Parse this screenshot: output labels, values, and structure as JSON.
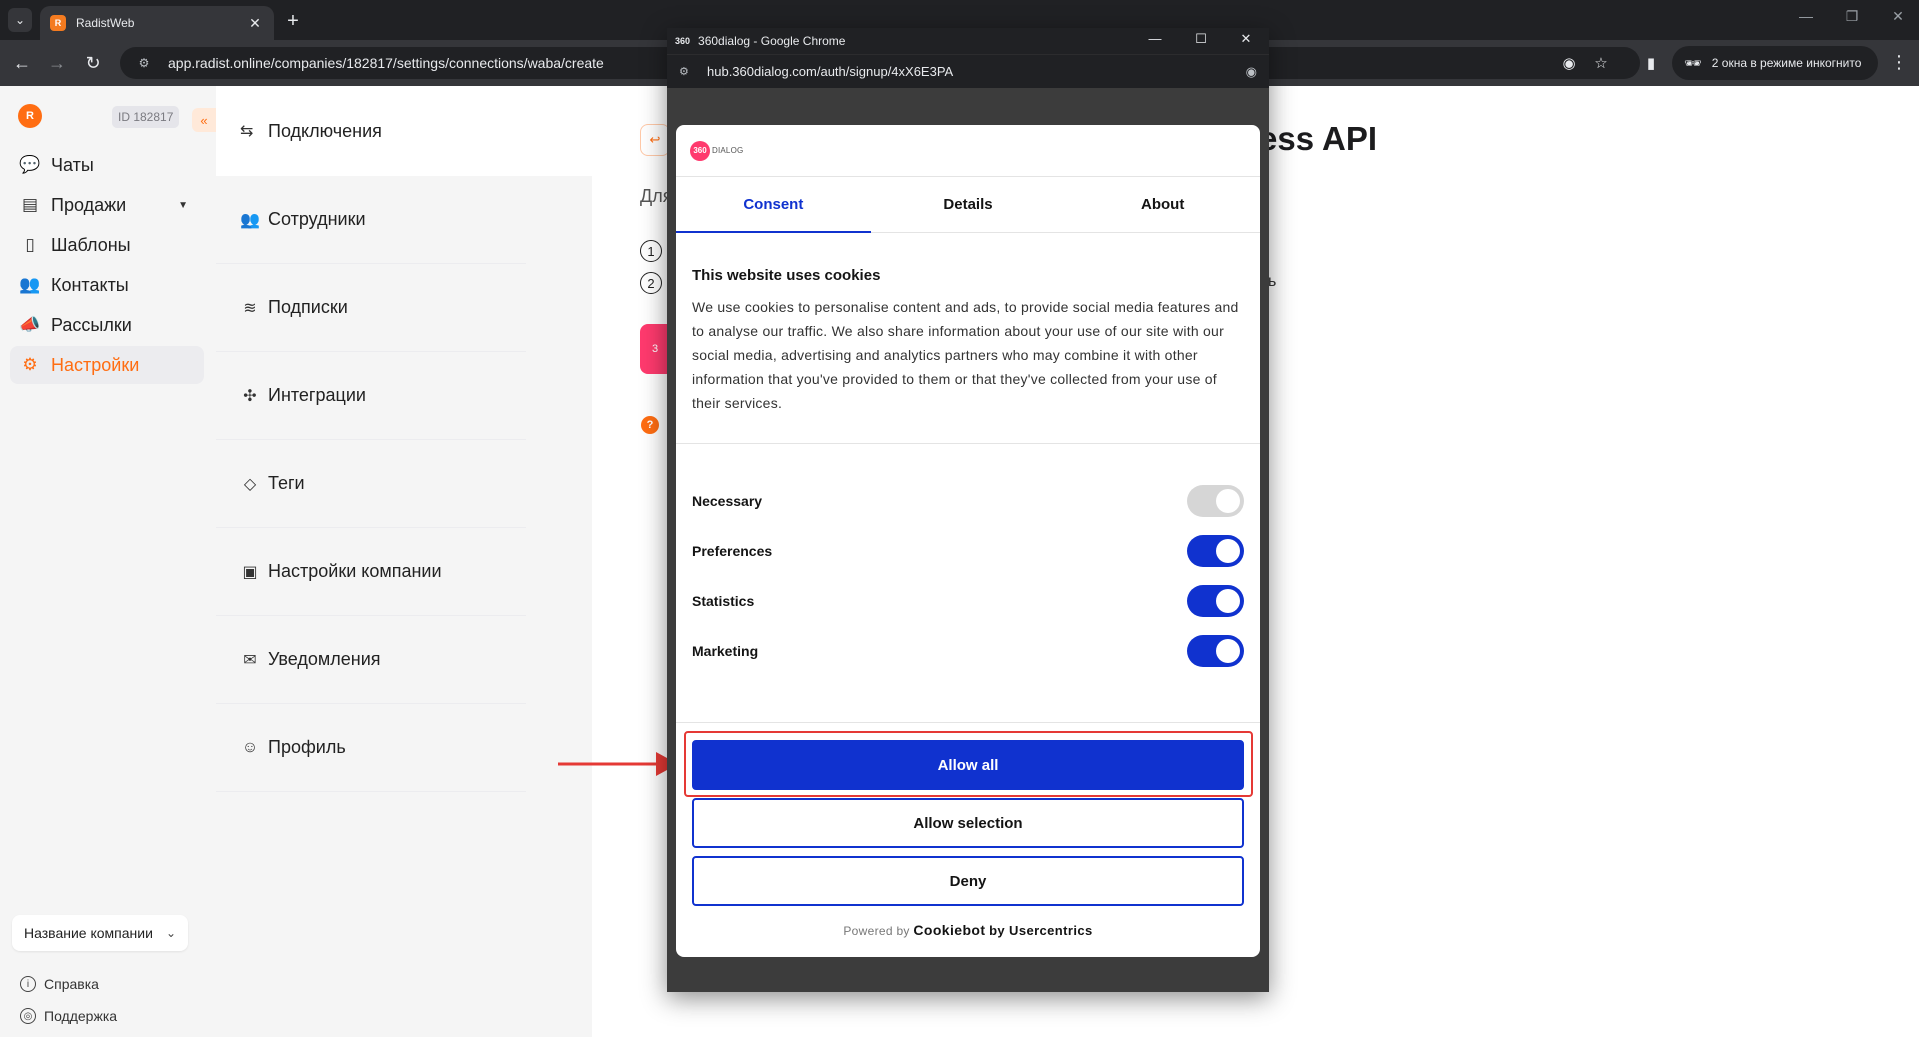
{
  "browser": {
    "tab_title": "RadistWeb",
    "url": "app.radist.online/companies/182817/settings/connections/waba/create",
    "incognito_label": "2 окна в режиме инкогнито"
  },
  "app": {
    "company_id": "ID 182817",
    "nav": [
      {
        "label": "Чаты",
        "icon": "chat-icon"
      },
      {
        "label": "Продажи",
        "icon": "sales-icon"
      },
      {
        "label": "Шаблоны",
        "icon": "templates-icon"
      },
      {
        "label": "Контакты",
        "icon": "contacts-icon"
      },
      {
        "label": "Рассылки",
        "icon": "megaphone-icon"
      },
      {
        "label": "Настройки",
        "icon": "gear-icon",
        "active": true
      }
    ],
    "company_select": "Название компании",
    "footer": {
      "help": "Справка",
      "support": "Поддержка"
    }
  },
  "settings_menu": {
    "header": "Подключения",
    "items": [
      {
        "label": "Сотрудники",
        "icon": "users-icon"
      },
      {
        "label": "Подписки",
        "icon": "subscriptions-icon"
      },
      {
        "label": "Интеграции",
        "icon": "puzzle-icon"
      },
      {
        "label": "Теги",
        "icon": "tag-icon"
      },
      {
        "label": "Настройки компании",
        "icon": "briefcase-icon"
      },
      {
        "label": "Уведомления",
        "icon": "mail-icon"
      },
      {
        "label": "Профиль",
        "icon": "ghost-icon"
      }
    ]
  },
  "main": {
    "title_fragment": "ess API",
    "intro_fragment": "Для",
    "steps": [
      "1",
      "2"
    ],
    "tail_fragment": "ь"
  },
  "popup": {
    "window_title": "360dialog - Google Chrome",
    "url": "hub.360dialog.com/auth/signup/4xX6E3PA",
    "logo_text": "360",
    "logo_word": "DIALOG"
  },
  "cookie": {
    "tabs": [
      "Consent",
      "Details",
      "About"
    ],
    "heading": "This website uses cookies",
    "body": "We use cookies to personalise content and ads, to provide social media features and to analyse our traffic. We also share information about your use of our site with our social media, advertising and analytics partners who may combine it with other information that you've provided to them or that they've collected from your use of their services.",
    "categories": [
      {
        "label": "Necessary",
        "enabled": true,
        "locked": true
      },
      {
        "label": "Preferences",
        "enabled": true
      },
      {
        "label": "Statistics",
        "enabled": true
      },
      {
        "label": "Marketing",
        "enabled": true
      }
    ],
    "buttons": {
      "allow_all": "Allow all",
      "allow_selection": "Allow selection",
      "deny": "Deny"
    },
    "powered_prefix": "Powered by",
    "powered_brand": "Cookiebot",
    "powered_suffix": "by Usercentrics"
  },
  "colors": {
    "brand_orange": "#ff6d12",
    "consent_blue": "#1032cf",
    "annotation_red": "#e53935"
  }
}
